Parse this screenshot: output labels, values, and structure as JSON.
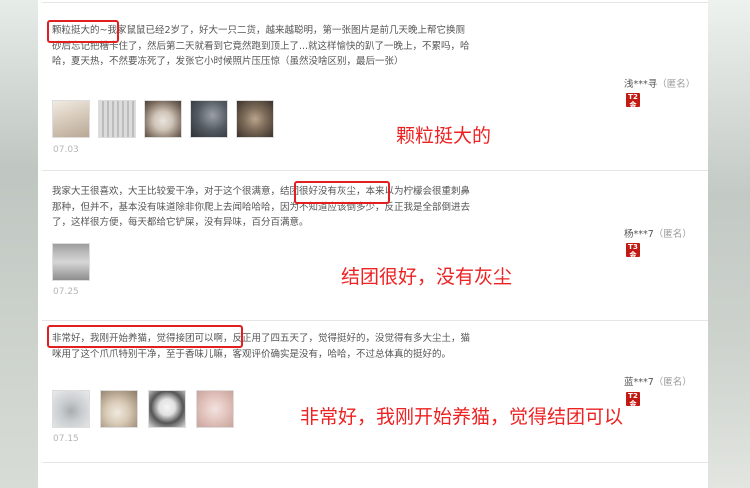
{
  "reviews": [
    {
      "text": "颗粒挺大的~我家鼠鼠已经2岁了，好大一只二货，越来越聪明，第一张图片是前几天晚上帮它换厕砂后忘记把槽卡住了，然后第二天就看到它竟然跑到顶上了...就这样愉快的趴了一晚上，不累吗，哈哈，夏天热，不然要冻死了，发张它小时候照片压压惊（虽然没啥区别，最后一张）",
      "user": "浅***寻",
      "anon": "（匿名）",
      "level": [
        "T2",
        "金"
      ],
      "date": "07.03",
      "annotation": "颗粒挺大的",
      "photo_count": 5
    },
    {
      "text": "我家大王很喜欢，大王比较爱干净，对于这个很满意，结团很好没有灰尘，本来以为柠檬会很重刺鼻那种，但并不，基本没有味道除非你爬上去闻哈哈哈，因为不知道应该倒多少，反正我是全部倒进去了，这样很方便，每天都给它铲屎，没有异味，百分百满意。",
      "user": "杨***7",
      "anon": "（匿名）",
      "level": [
        "T3",
        "金"
      ],
      "date": "07.25",
      "annotation": "结团很好，没有灰尘",
      "photo_count": 1
    },
    {
      "text": "非常好，我刚开始养猫，觉得接团可以啊，反正用了四五天了，觉得挺好的，没觉得有多大尘土，猫咪用了这个爪爪特别干净，至于香味儿嘛，客观评价确实是没有，哈哈，不过总体真的挺好的。",
      "user": "蓝***7",
      "anon": "（匿名）",
      "level": [
        "T2",
        "金"
      ],
      "date": "07.15",
      "annotation": "非常好，我刚开始养猫，觉得结团可以",
      "photo_count": 4
    }
  ]
}
